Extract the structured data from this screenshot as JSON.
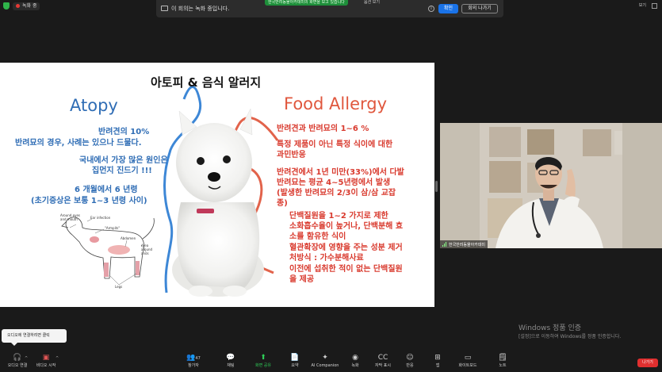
{
  "top_bar": {
    "recording_label": "녹화 중",
    "banner_text": "이 회의는 녹화 중입니다.",
    "share_notice": "한국반려동물아카데미의 화면을 보고 있습니다",
    "view_options": "옵션 보기",
    "confirm_label": "확인",
    "leave_meeting_label": "회의 나가기",
    "gallery_label": "보기"
  },
  "slide": {
    "title": "아토피 & 음식 알러지",
    "atopy": {
      "heading": "Atopy",
      "lines": [
        "반려견의 10%",
        "반려묘의 경우, 사례는 있으나 드물다.",
        "국내에서 가장 많은 원인은",
        "집먼지 진드기 !!!",
        "6 개월에서 6 년령",
        "(초기증상은 보통 1~3 년령 사이)"
      ]
    },
    "diagram_labels": {
      "eyes_mouth": "Around eyes\nand mouth",
      "ear": "Ear infection",
      "armpits": "\"Armpits\"",
      "abdomen": "Abdomen",
      "anus": "Area\naround\nanus",
      "legs": "Legs"
    },
    "food": {
      "heading": "Food Allergy",
      "lines": [
        "반려견과 반려묘의 1~6 %",
        "특정 제품이 아닌 특정 식이에 대한",
        "과민반응",
        "반려견에서 1년 미만(33%)에서 다발",
        "반려묘는 평균 4~5년령에서 발생",
        "(발생한 반려묘의 2/3이 삼/삼 교잡",
        "종)",
        "단백질원을 1~2 가지로 제한",
        "소화흡수율이 높거나, 단백분해 효",
        "소를 함유한 식이",
        "혈관확장에 영향을 주는 성분 제거",
        "처방식 : 가수분해사료",
        "이전에 섭취한 적이 없는 단백질원",
        "을 제공"
      ]
    }
  },
  "video": {
    "participant_name": "한국반려동물아카데미"
  },
  "watermark": {
    "title": "Windows 정품 인증",
    "subtitle": "[설정]으로 이동하여 Windows를 정품 인증합니다."
  },
  "audio_tooltip": "오디오에 연결하려면 클릭",
  "toolbar": {
    "audio": "오디오 연결",
    "video": "비디오 시작",
    "participants": "참가자",
    "participants_count": "47",
    "chat": "채팅",
    "share": "화면 공유",
    "summary": "요약",
    "ai": "AI Companion",
    "record": "녹화",
    "captions": "자막 표시",
    "reactions": "반응",
    "apps": "앱",
    "whiteboard": "화이트보드",
    "notes": "노트",
    "leave": "나가기"
  },
  "colors": {
    "atopy_blue": "#2f6db5",
    "food_red": "#d93a2e",
    "share_green": "#2fd159",
    "confirm_blue": "#1a73e8",
    "leave_red": "#e02f2f"
  }
}
